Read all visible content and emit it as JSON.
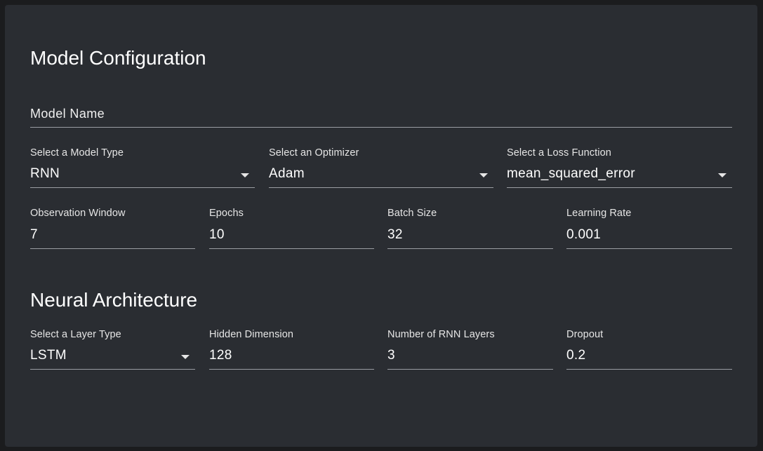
{
  "model_config": {
    "title": "Model Configuration",
    "model_name": {
      "label": "Model Name",
      "value": ""
    },
    "model_type": {
      "label": "Select a Model Type",
      "value": "RNN"
    },
    "optimizer": {
      "label": "Select an Optimizer",
      "value": "Adam"
    },
    "loss_function": {
      "label": "Select a Loss Function",
      "value": "mean_squared_error"
    },
    "observation_window": {
      "label": "Observation Window",
      "value": "7"
    },
    "epochs": {
      "label": "Epochs",
      "value": "10"
    },
    "batch_size": {
      "label": "Batch Size",
      "value": "32"
    },
    "learning_rate": {
      "label": "Learning Rate",
      "value": "0.001"
    }
  },
  "neural_architecture": {
    "title": "Neural Architecture",
    "layer_type": {
      "label": "Select a Layer Type",
      "value": "LSTM"
    },
    "hidden_dimension": {
      "label": "Hidden Dimension",
      "value": "128"
    },
    "rnn_layers": {
      "label": "Number of RNN Layers",
      "value": "3"
    },
    "dropout": {
      "label": "Dropout",
      "value": "0.2"
    }
  },
  "icons": {
    "dropdown": "triangle-down"
  }
}
